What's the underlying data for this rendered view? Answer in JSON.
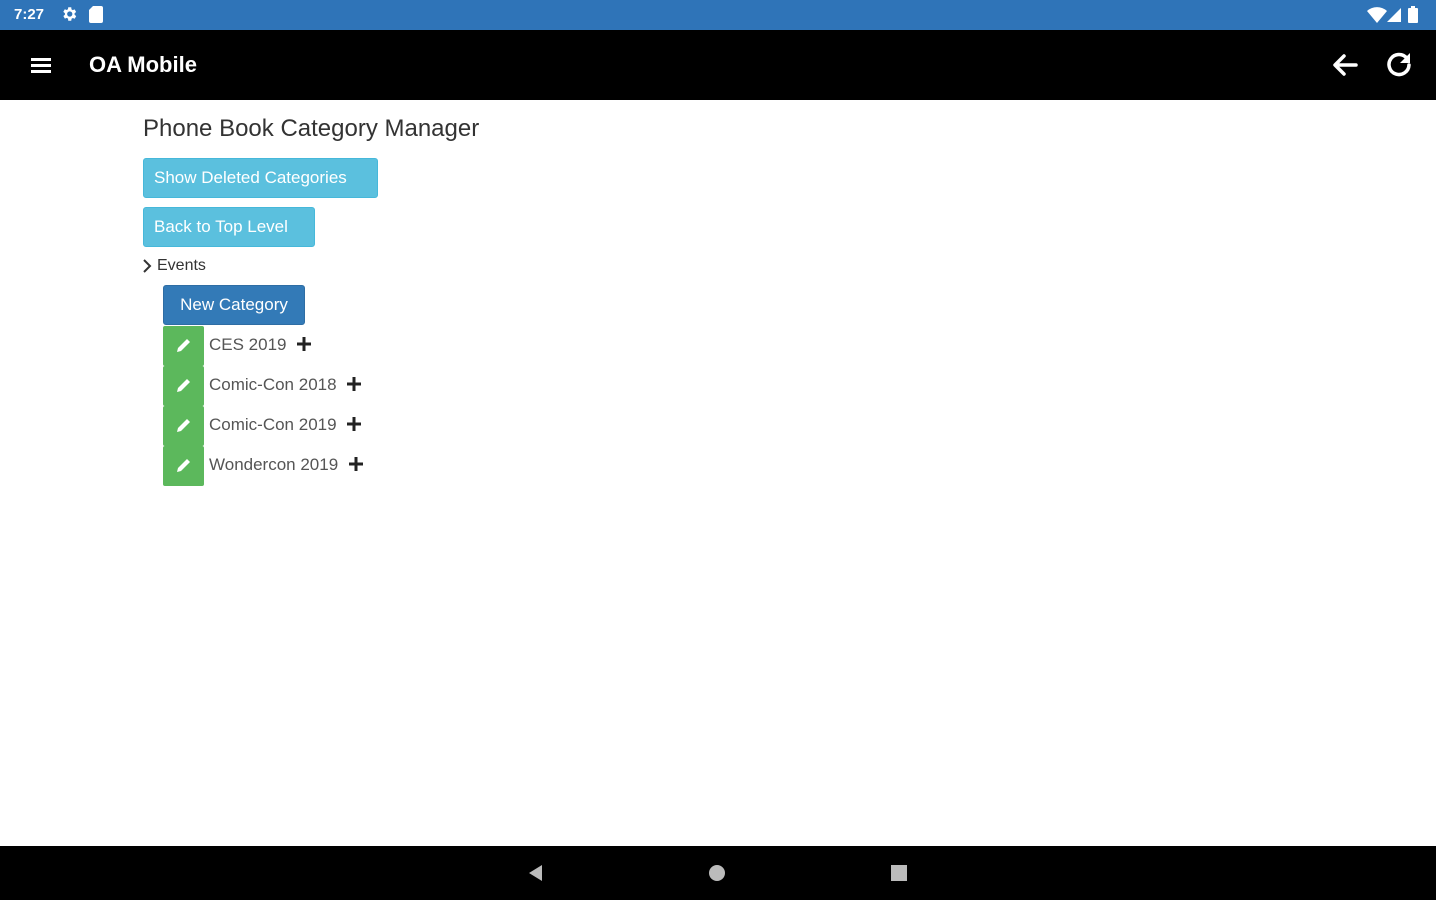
{
  "status_bar": {
    "time": "7:27",
    "icons": [
      "gear-icon",
      "sd-card-icon",
      "wifi-icon",
      "signal-icon",
      "battery-icon"
    ]
  },
  "app_bar": {
    "title": "OA Mobile",
    "icons": [
      "menu-icon",
      "arrow-back-icon",
      "refresh-icon"
    ]
  },
  "page": {
    "title": "Phone Book Category Manager",
    "show_deleted_label": "Show Deleted Categories",
    "back_top_label": "Back to Top Level",
    "tree_root": "Events",
    "new_category_label": "New Category",
    "categories": [
      {
        "name": "CES 2019"
      },
      {
        "name": "Comic-Con 2018"
      },
      {
        "name": "Comic-Con 2019"
      },
      {
        "name": "Wondercon 2019"
      }
    ]
  },
  "colors": {
    "status_bar": "#2f74b8",
    "app_bar": "#000000",
    "info_button": "#5bc0de",
    "primary_button": "#337ab7",
    "edit_button": "#5cb85c"
  },
  "nav_bar": {
    "icons": [
      "nav-back-icon",
      "nav-home-icon",
      "nav-recents-icon"
    ]
  }
}
